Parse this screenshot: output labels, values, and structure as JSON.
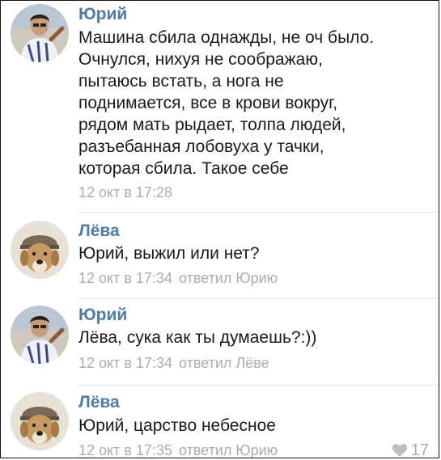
{
  "comments": [
    {
      "author": "Юрий",
      "lines": [
        "Машина сбила однажды, не оч было.",
        "Очнулся, нихуя не соображаю,",
        "пытаюсь встать, а нога не",
        "поднимается, все в крови вокруг,",
        "рядом мать рыдает, толпа людей,",
        "разъебанная лобовуха у тачки,",
        "которая сбила. Такое себе"
      ],
      "time": "12 окт в 17:28",
      "reply": ""
    },
    {
      "author": "Лёва",
      "lines": [
        "Юрий, выжил или нет?"
      ],
      "time": "12 окт в 17:34",
      "reply": "ответил Юрию"
    },
    {
      "author": "Юрий",
      "lines": [
        "Лёва, сука как ты думаешь?:))"
      ],
      "time": "12 окт в 17:34",
      "reply": "ответил Лёве"
    },
    {
      "author": "Лёва",
      "lines": [
        "Юрий, царство небесное"
      ],
      "time": "12 окт в 17:35",
      "reply": "ответил Юрию",
      "likes": "17"
    }
  ],
  "colors": {
    "author": "#4f7ba5",
    "meta": "#a7adb4",
    "text": "#1a1a1a"
  },
  "icons": {
    "like": "heart-icon"
  }
}
